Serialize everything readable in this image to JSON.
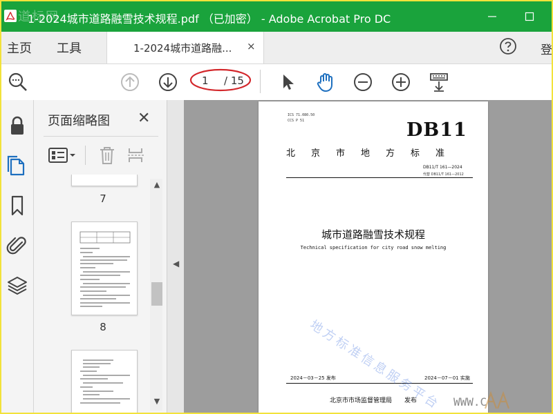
{
  "window": {
    "title": "1-2024城市道路融雪技术规程.pdf （已加密） - Adobe Acrobat Pro DC",
    "watermark_top": "道标网"
  },
  "menu": {
    "home": "主页",
    "tools": "工具",
    "login": "登"
  },
  "doc_tab": {
    "label": "1-2024城市道路融...",
    "close": "×"
  },
  "toolbar": {
    "page_current": "1",
    "page_total": "/ 15"
  },
  "thumbnails": {
    "title": "页面缩略图",
    "close": "✕",
    "pages": [
      {
        "num": "7"
      },
      {
        "num": "8"
      }
    ]
  },
  "document": {
    "ics": "ICS 71.080.50",
    "ccs": "CCS P 51",
    "code": "DB11",
    "region": "北京市地方标准",
    "number": "DB11/T 161—2024",
    "replaces": "代替 DB11/T 161—2012",
    "title": "城市道路融雪技术规程",
    "title_en": "Technical specification for city road snow melting",
    "issue_date": "2024－03－25 发布",
    "impl_date": "2024－07－01 实施",
    "publisher": "北京市市场监督管理局　　发布"
  },
  "watermark": {
    "text": "地方标准信息服务平台",
    "www": "WWW.C"
  },
  "colors": {
    "titlebar": "#1aa33c",
    "accent": "#1d6fbf",
    "annotation": "#d3272b"
  }
}
